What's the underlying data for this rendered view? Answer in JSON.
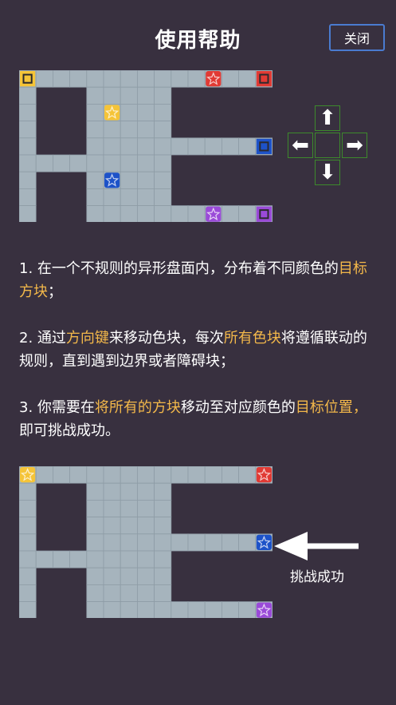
{
  "header": {
    "title": "使用帮助",
    "close_label": "关闭"
  },
  "dpad": {
    "up": "⬆",
    "left": "⬅",
    "right": "➡",
    "down": "⬇"
  },
  "help": {
    "p1": {
      "t1": "1. 在一个不规则的异形盘面内，分布着不同颜色的",
      "h1": "目标方块",
      "t2": "；"
    },
    "p2": {
      "t1": "2. 通过",
      "h1": "方向键",
      "t2": "来移动色块，每次",
      "h2": "所有色块",
      "t3": "将遵循联动的规则，直到遇到边界或者障碍块；"
    },
    "p3": {
      "t1": "3. 你需要在",
      "h1": "将所有的方块",
      "t2": "移动至对应颜色的",
      "h2": "目标位置，",
      "t3": "即可挑战成功。"
    }
  },
  "success_label": "挑战成功",
  "colors": {
    "yellow": "#f5c438",
    "red": "#e13a34",
    "blue": "#1d52c8",
    "purple": "#9a4ad8",
    "tile": "#a6b4bd",
    "highlight": "#f3b84a",
    "dpad_border": "#3d8a2c"
  },
  "boards": [
    {
      "name": "before",
      "pieces": [
        {
          "kind": "target",
          "color": "yellow",
          "col": 0,
          "row": 0
        },
        {
          "kind": "star",
          "color": "red",
          "col": 11,
          "row": 0
        },
        {
          "kind": "target",
          "color": "red",
          "col": 14,
          "row": 0
        },
        {
          "kind": "star",
          "color": "yellow",
          "col": 5,
          "row": 2
        },
        {
          "kind": "target",
          "color": "blue",
          "col": 14,
          "row": 4
        },
        {
          "kind": "star",
          "color": "blue",
          "col": 5,
          "row": 6
        },
        {
          "kind": "star",
          "color": "purple",
          "col": 11,
          "row": 8
        },
        {
          "kind": "target",
          "color": "purple",
          "col": 14,
          "row": 8
        }
      ]
    },
    {
      "name": "after",
      "pieces": [
        {
          "kind": "star",
          "color": "yellow",
          "col": 0,
          "row": 0
        },
        {
          "kind": "star",
          "color": "red",
          "col": 14,
          "row": 0
        },
        {
          "kind": "star",
          "color": "blue",
          "col": 14,
          "row": 4
        },
        {
          "kind": "star",
          "color": "purple",
          "col": 14,
          "row": 8
        }
      ]
    }
  ]
}
